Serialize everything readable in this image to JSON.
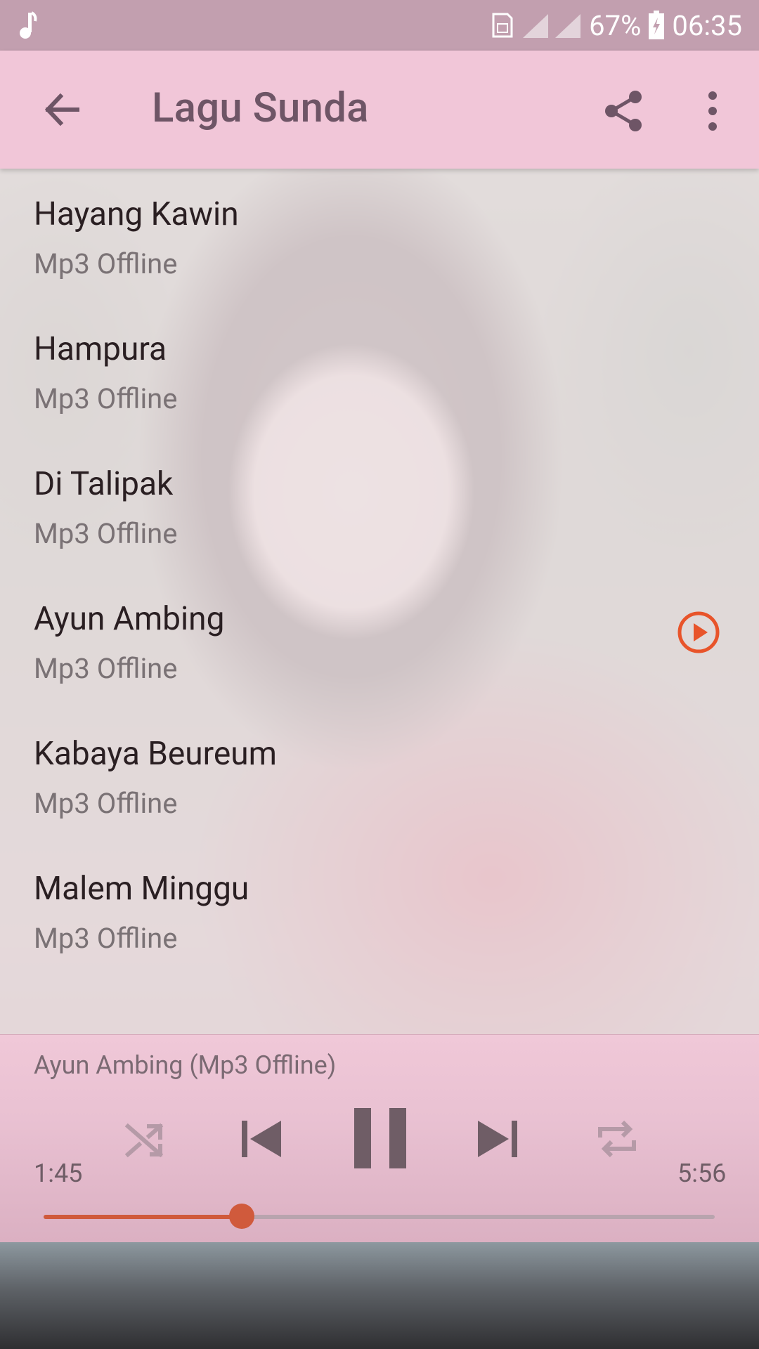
{
  "status_bar": {
    "battery": "67%",
    "time": "06:35",
    "icons": [
      "music-note-icon",
      "sim-card-icon",
      "signal-icon",
      "battery-icon"
    ]
  },
  "app_bar": {
    "title": "Lagu Sunda",
    "back_icon": "arrow-back-icon",
    "share_icon": "share-icon",
    "more_icon": "more-vert-icon"
  },
  "songs": [
    {
      "title": "Hayang Kawin",
      "subtitle": "Mp3 Offline"
    },
    {
      "title": "Hampura",
      "subtitle": "Mp3 Offline"
    },
    {
      "title": "Di Talipak",
      "subtitle": "Mp3 Offline"
    },
    {
      "title": "Ayun Ambing",
      "subtitle": "Mp3 Offline"
    },
    {
      "title": "Kabaya Beureum",
      "subtitle": "Mp3 Offline"
    },
    {
      "title": "Malem Minggu",
      "subtitle": "Mp3 Offline"
    }
  ],
  "now_playing_index": 3,
  "player": {
    "now_playing": "Ayun Ambing (Mp3 Offline)",
    "elapsed": "1:45",
    "duration": "5:56",
    "progress": 0.295,
    "accent_color": "#d05a3c"
  }
}
